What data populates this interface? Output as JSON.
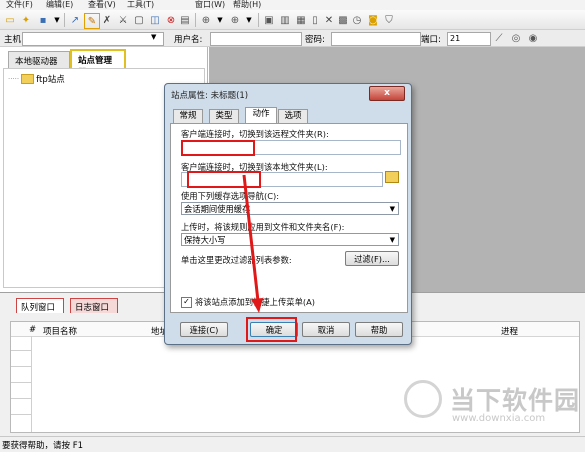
{
  "menu": [
    "文件(F)",
    "编辑(E)",
    "查看(V)",
    "工具(T)",
    "窗口(W)",
    "帮助(H)"
  ],
  "connection": {
    "host_label": "主机:",
    "user_label": "用户名:",
    "password_label": "密码:",
    "port_label": "端口:",
    "port_value": "21"
  },
  "left_tabs": {
    "local": "本地驱动器",
    "site_manager": "站点管理器"
  },
  "tree": {
    "root": "ftp站点"
  },
  "queue": {
    "tab_queue": "队列窗口",
    "tab_log": "日志窗口",
    "columns": [
      "#",
      "项目名称",
      "地址",
      "进程"
    ]
  },
  "status_bar": "要获得帮助，请按 F1",
  "dialog": {
    "title": "站点属性: 未标题(1)",
    "close": "x",
    "tabs": [
      "常规",
      "类型",
      "动作",
      "选项"
    ],
    "active_tab": "动作",
    "remote_label": "客户端连接时，切换到该远程文件夹(R):",
    "local_label": "客户端连接时，切换到该本地文件夹(L):",
    "cache_label": "使用下列缓存选项导航(C):",
    "cache_value": "会话期间使用缓存",
    "case_label": "上传时，将该规则应用到文件和文件夹名(F):",
    "case_value": "保持大小写",
    "filter_label": "单击这里更改过滤器列表参数:",
    "filter_button": "过滤(F)...",
    "checkbox_label": "将该站点添加到快捷上传菜单(A)",
    "checkbox_checked": true,
    "buttons": {
      "connect": "连接(C)",
      "ok": "确定",
      "cancel": "取消",
      "help": "帮助"
    }
  },
  "watermark": {
    "text": "当下软件园",
    "url": "www.downxia.com"
  },
  "colors": {
    "highlight_red": "#e01818",
    "tab_yellow": "#e0c020",
    "gray_area": "#b3b3b3"
  }
}
